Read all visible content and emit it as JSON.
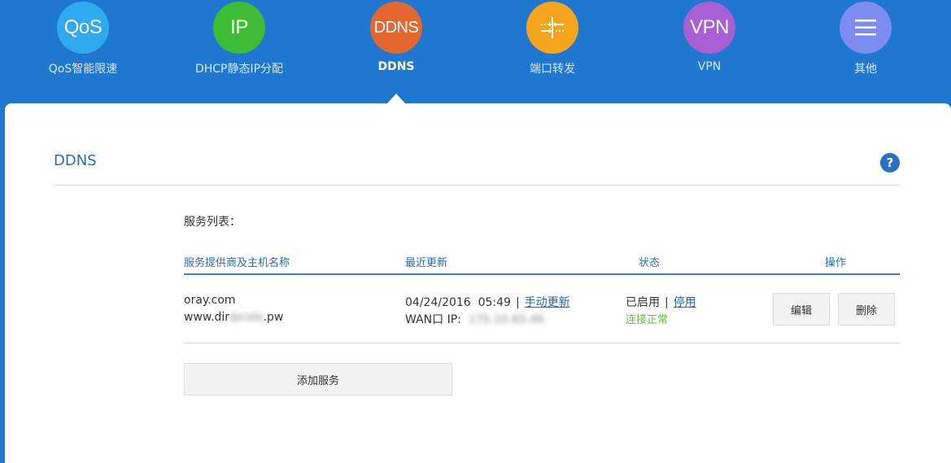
{
  "nav": {
    "items": [
      {
        "icon_text": "QoS",
        "label": "QoS智能限速",
        "color": "#2ea8ef"
      },
      {
        "icon_text": "IP",
        "label": "DHCP静态IP分配",
        "color": "#3cbd35"
      },
      {
        "icon_text": "DDNS",
        "label": "DDNS",
        "color": "#e3672e"
      },
      {
        "icon_text": "",
        "label": "端口转发",
        "color": "#f5a51d"
      },
      {
        "icon_text": "VPN",
        "label": "VPN",
        "color": "#a85fd6"
      },
      {
        "icon_text": "",
        "label": "其他",
        "color": "#7d8cf0"
      }
    ],
    "active_index": 2
  },
  "panel": {
    "title": "DDNS",
    "help": "?",
    "list_label": "服务列表："
  },
  "table": {
    "headers": [
      "服务提供商及主机名称",
      "最近更新",
      "状态",
      "操作"
    ],
    "row": {
      "provider": "oray.com",
      "host_prefix": "www.dir",
      "host_hidden": "ipcolo",
      "host_suffix": ".pw",
      "date": "04/24/2016",
      "time": "05:49",
      "sep": "|",
      "manual_update": "手动更新",
      "wan_label": "WAN口 IP:",
      "wan_ip_hidden": "175.10.65.46",
      "status_enabled": "已启用",
      "disable_link": "停用",
      "conn_status": "连接正常",
      "edit_label": "编辑",
      "delete_label": "删除"
    }
  },
  "add_service_label": "添加服务"
}
